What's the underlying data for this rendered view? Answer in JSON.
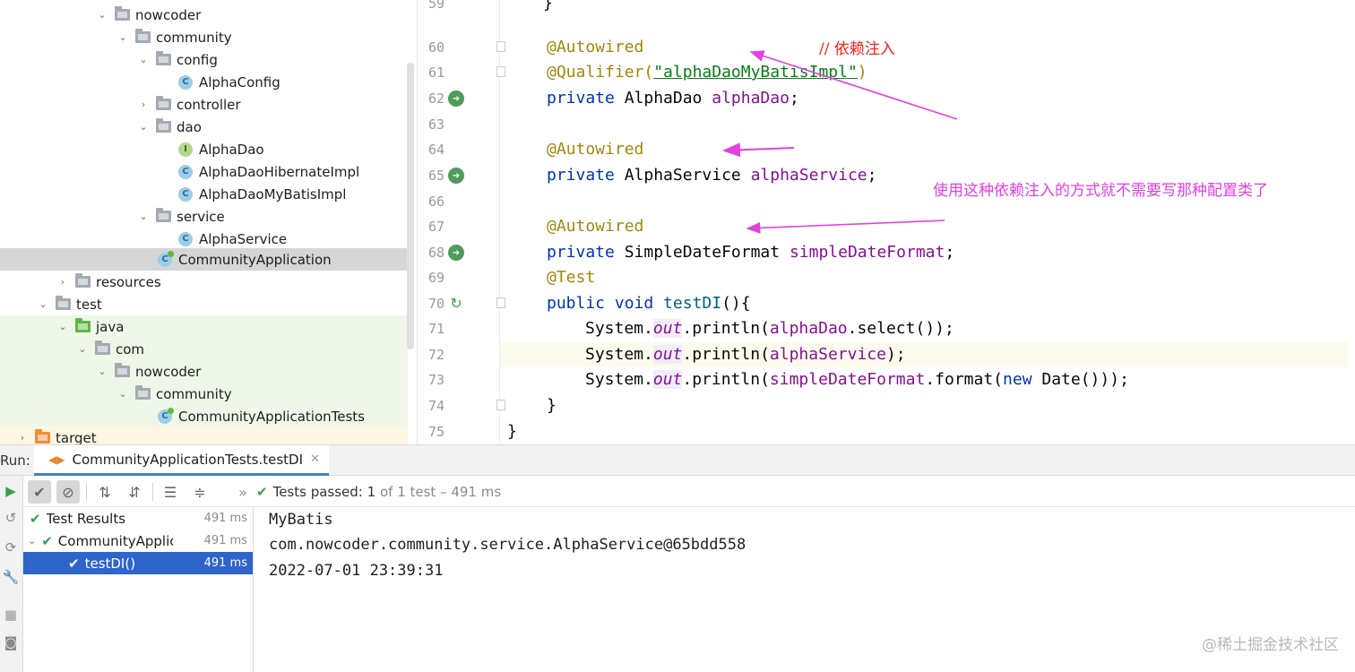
{
  "project_tree": {
    "items": [
      {
        "label": "nowcoder",
        "icon": "folder",
        "expanded": true
      },
      {
        "label": "community",
        "icon": "folder",
        "expanded": true
      },
      {
        "label": "config",
        "icon": "folder",
        "expanded": true
      },
      {
        "label": "AlphaConfig",
        "icon": "class"
      },
      {
        "label": "controller",
        "icon": "folder",
        "expanded": false
      },
      {
        "label": "dao",
        "icon": "folder",
        "expanded": true
      },
      {
        "label": "AlphaDao",
        "icon": "interface"
      },
      {
        "label": "AlphaDaoHibernateImpl",
        "icon": "class"
      },
      {
        "label": "AlphaDaoMyBatisImpl",
        "icon": "class"
      },
      {
        "label": "service",
        "icon": "folder",
        "expanded": true
      },
      {
        "label": "AlphaService",
        "icon": "class"
      },
      {
        "label": "CommunityApplication",
        "icon": "spring-app-class",
        "selected": true
      },
      {
        "label": "resources",
        "icon": "resources-folder",
        "expanded": false
      },
      {
        "label": "test",
        "icon": "folder",
        "expanded": true
      },
      {
        "label": "java",
        "icon": "test-source-folder",
        "expanded": true
      },
      {
        "label": "com",
        "icon": "folder",
        "expanded": true
      },
      {
        "label": "nowcoder",
        "icon": "folder",
        "expanded": true
      },
      {
        "label": "community",
        "icon": "folder",
        "expanded": true
      },
      {
        "label": "CommunityApplicationTests",
        "icon": "spring-app-class"
      },
      {
        "label": "target",
        "icon": "excluded-folder",
        "expanded": false
      }
    ]
  },
  "editor": {
    "line_numbers": [
      "59",
      "60",
      "61",
      "62",
      "63",
      "64",
      "65",
      "66",
      "67",
      "68",
      "69",
      "70",
      "71",
      "72",
      "73",
      "74",
      "75"
    ],
    "code": {
      "l60_annotation": "@Autowired",
      "l61_annotation": "@Qualifier(",
      "l61_string": "\"alphaDaoMyBatisImpl\"",
      "l61_close": ")",
      "l62_kw": "private",
      "l62_type": " AlphaDao ",
      "l62_field": "alphaDao",
      "l62_end": ";",
      "l64_annotation": "@Autowired",
      "l65_kw": "private",
      "l65_type": " AlphaService ",
      "l65_field": "alphaService",
      "l65_end": ";",
      "l67_annotation": "@Autowired",
      "l68_kw": "private",
      "l68_type": " SimpleDateFormat ",
      "l68_field": "simpleDateFormat",
      "l68_end": ";",
      "l69_annotation": "@Test",
      "l70_kw": "public void",
      "l70_method": " testDI",
      "l70_end": "(){",
      "l71_sys": "System.",
      "l71_out": "out",
      "l71_mid": ".println(",
      "l71_field": "alphaDao",
      "l71_end": ".select());",
      "l72_sys": "System.",
      "l72_out": "out",
      "l72_mid": ".println(",
      "l72_field": "alphaService",
      "l72_end": ");",
      "l73_sys": "System.",
      "l73_out": "out",
      "l73_mid": ".println(",
      "l73_field": "simpleDateFormat",
      "l73_mid2": ".format(",
      "l73_kw": "new",
      "l73_end": " Date()));",
      "l74": "}",
      "l75": "}",
      "l58": "}"
    },
    "annotations": {
      "comment": "//  依赖注入",
      "note": "使用这种依赖注入的方式就不需要写那种配置类了",
      "arrow_color": "#e43fe0",
      "comment_color": "#f5221b"
    }
  },
  "run_panel": {
    "label": "Run:",
    "tab": "CommunityApplicationTests.testDI",
    "status": {
      "prefix": "Tests passed:",
      "passed": "1",
      "rest": "of 1 test – 491 ms"
    },
    "results": [
      {
        "label": "Test Results",
        "duration": "491 ms"
      },
      {
        "label": "CommunityApplicationTests",
        "duration": "491 ms"
      },
      {
        "label": "testDI()",
        "duration": "491 ms",
        "selected": true
      }
    ],
    "console": [
      "MyBatis",
      "com.nowcoder.community.service.AlphaService@65bdd558",
      "2022-07-01 23:39:31"
    ]
  },
  "watermark": "@稀土掘金技术社区",
  "colors": {
    "pass": "#3f9d4f",
    "selection": "#2f65ca",
    "annotation": "#9e880d",
    "keyword": "#0033b3",
    "field": "#871094"
  }
}
